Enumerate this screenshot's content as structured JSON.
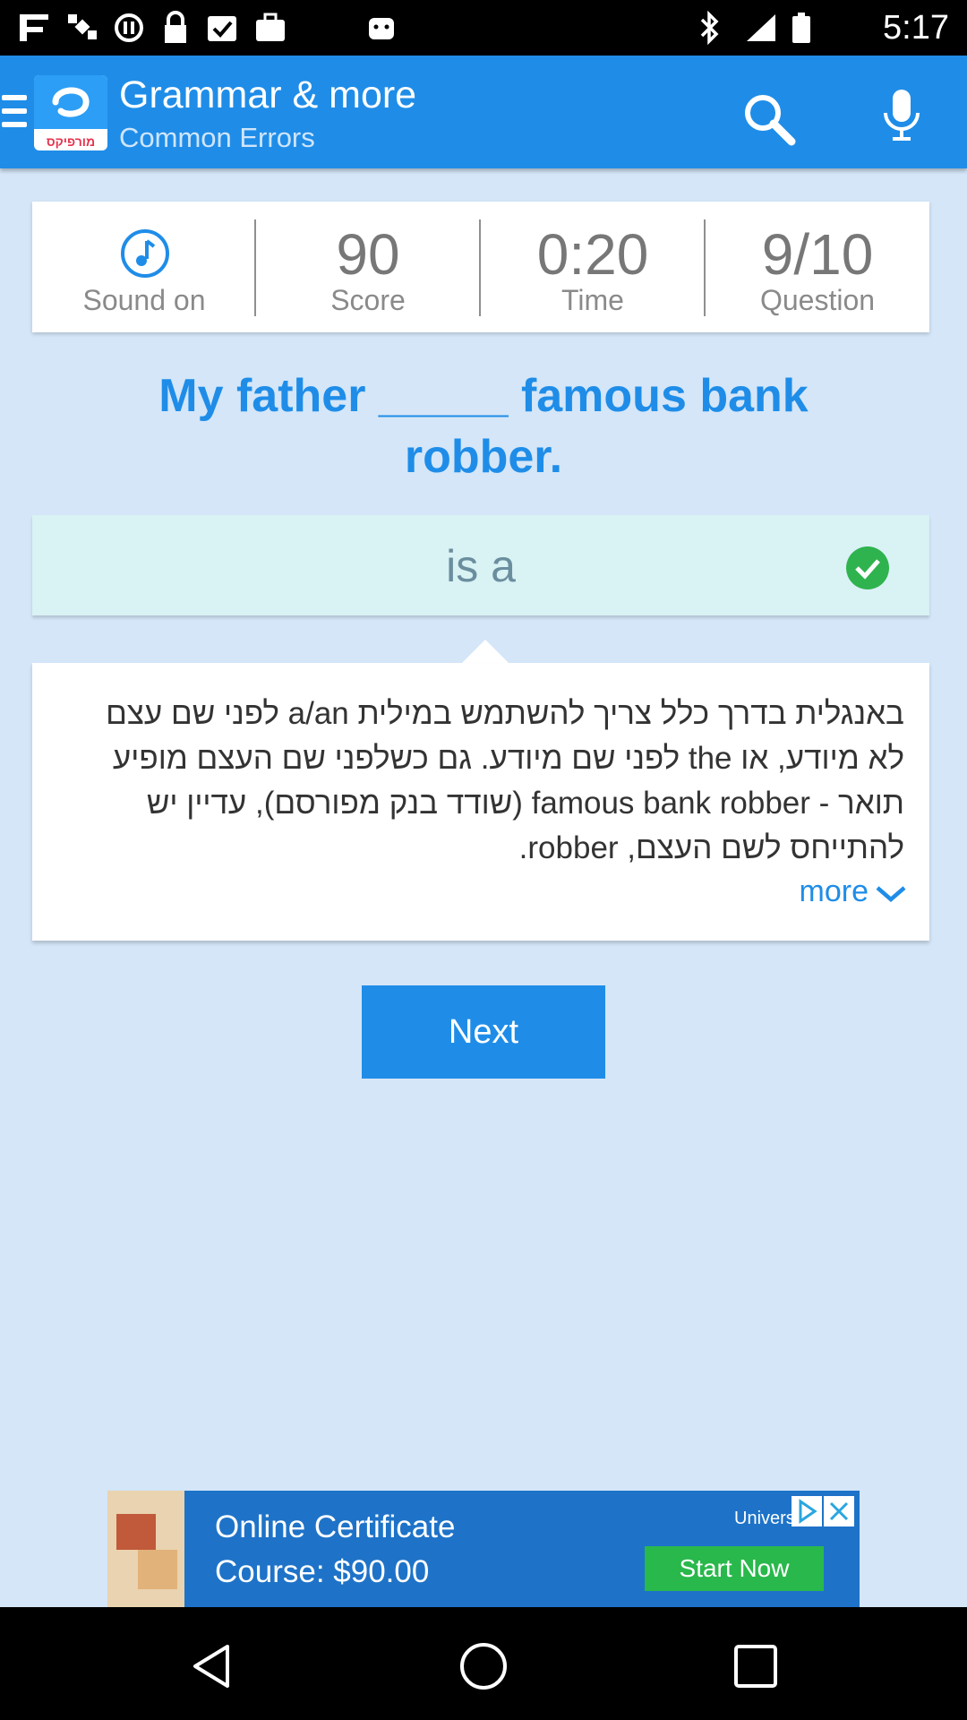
{
  "status_bar": {
    "time": "5:17",
    "left_icons": [
      "fake-gps-icon",
      "satellite-icon",
      "circle-icon",
      "lock-icon",
      "checkbox-icon",
      "briefcase-icon",
      "android-icon"
    ],
    "right_icons": [
      "bluetooth-icon",
      "signal-icon",
      "battery-icon"
    ]
  },
  "app_bar": {
    "title": "Grammar & more",
    "subtitle": "Common Errors",
    "logo_text": "מורפיקס",
    "icons": [
      "menu-icon",
      "search-icon",
      "microphone-icon"
    ],
    "color": "#1f8de8"
  },
  "stats": {
    "sound_label": "Sound on",
    "score_value": "90",
    "score_label": "Score",
    "time_value": "0:20",
    "time_label": "Time",
    "question_value": "9/10",
    "question_label": "Question"
  },
  "quiz": {
    "question": "My father _____ famous bank robber.",
    "selected_answer": "is a",
    "answer_status": "correct",
    "explanation": "באנגלית בדרך כלל צריך להשתמש במילית a/an לפני שם עצם לא מיודע, או the לפני שם מיודע. גם כשלפני שם העצם מופיע תואר - famous bank robber (שודד בנק מפורסם), עדיין יש להתייחס לשם העצם, robber.",
    "more_label": "more",
    "next_label": "Next"
  },
  "ad": {
    "text_line1": "Online Certificate",
    "text_line2": "Course: $90.00",
    "brand": "Universal",
    "cta": "Start Now",
    "color": "#1e73c8",
    "cta_color": "#29b84b"
  },
  "nav_bar": {
    "icons": [
      "back-icon",
      "home-icon",
      "recents-icon"
    ]
  }
}
